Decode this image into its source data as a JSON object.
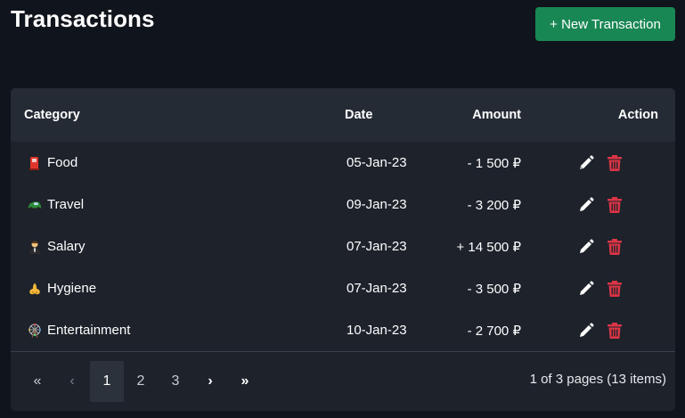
{
  "header": {
    "title": "Transactions",
    "new_button_label": "+ New Transaction"
  },
  "table": {
    "columns": {
      "category": "Category",
      "date": "Date",
      "amount": "Amount",
      "action": "Action"
    },
    "rows": [
      {
        "icon": "fuel-pump-icon",
        "category": "Food",
        "date": "05-Jan-23",
        "amount": "- 1 500 ₽"
      },
      {
        "icon": "car-icon",
        "category": "Travel",
        "date": "09-Jan-23",
        "amount": "- 3 200 ₽"
      },
      {
        "icon": "person-in-suit-icon",
        "category": "Salary",
        "date": "07-Jan-23",
        "amount": "+ 14 500 ₽"
      },
      {
        "icon": "nose-icon",
        "category": "Hygiene",
        "date": "07-Jan-23",
        "amount": "- 3 500 ₽"
      },
      {
        "icon": "ferris-wheel-icon",
        "category": "Entertainment",
        "date": "10-Jan-23",
        "amount": "- 2 700 ₽"
      }
    ]
  },
  "pagination": {
    "first": "«",
    "prev": "‹",
    "pages": [
      "1",
      "2",
      "3"
    ],
    "current_page": "1",
    "next": "›",
    "last": "»",
    "info": "1 of 3 pages (13 items)"
  },
  "colors": {
    "background": "#10141c",
    "card": "#1d222b",
    "header_row": "#252b35",
    "primary_button": "#198754",
    "delete_icon": "#dc3545",
    "edit_icon": "#ffffff"
  }
}
